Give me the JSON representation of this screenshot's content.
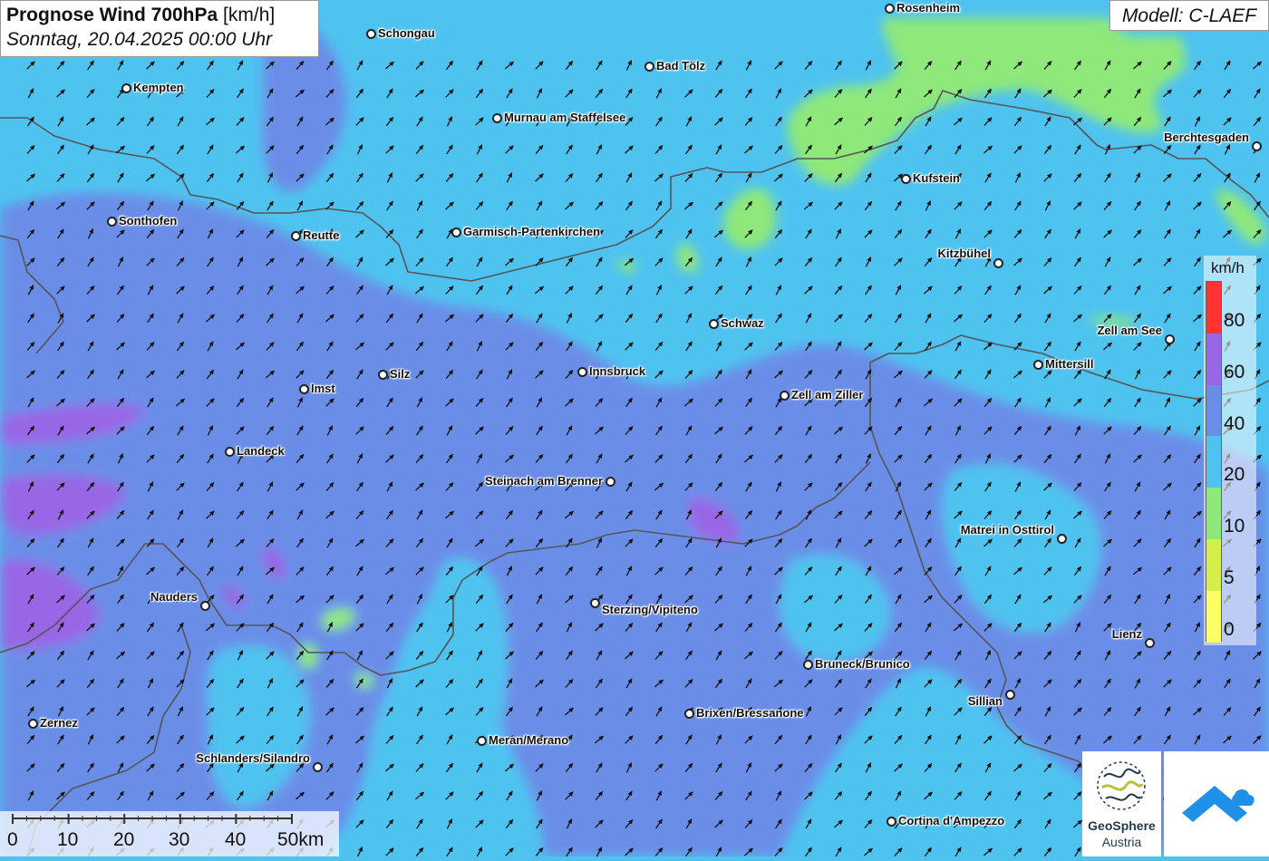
{
  "header": {
    "title_bold": "Prognose Wind 700hPa",
    "title_unit": "[km/h]",
    "subtitle": "Sonntag, 20.04.2025 00:00 Uhr",
    "model": "Modell: C-LAEF"
  },
  "colors": {
    "speed_0_5": "#ffff66",
    "speed_5_10": "#d4ef4a",
    "speed_10_20": "#8ee87a",
    "speed_20_40": "#4fc3f0",
    "speed_40_60": "#6a8ee8",
    "speed_60_80": "#9966e6",
    "speed_80_plus": "#ff3333",
    "border": "#555555",
    "arrow": "#111111"
  },
  "legend": {
    "unit": "km/h",
    "labels": [
      "80",
      "60",
      "40",
      "20",
      "10",
      "5",
      "0"
    ]
  },
  "scale_bar": {
    "labels": [
      "0",
      "10",
      "20",
      "30",
      "40",
      "50km"
    ]
  },
  "cities": [
    {
      "name": "Rosenheim"
    },
    {
      "name": "Schongau"
    },
    {
      "name": "Bad Tölz"
    },
    {
      "name": "Kempten"
    },
    {
      "name": "Murnau am Staffelsee"
    },
    {
      "name": "Berchtesgaden"
    },
    {
      "name": "Kufstein"
    },
    {
      "name": "Sonthofen"
    },
    {
      "name": "Reutte"
    },
    {
      "name": "Garmisch-Partenkirchen"
    },
    {
      "name": "Kitzbühel"
    },
    {
      "name": "Schwaz"
    },
    {
      "name": "Zell am See"
    },
    {
      "name": "Mittersill"
    },
    {
      "name": "Silz"
    },
    {
      "name": "Innsbruck"
    },
    {
      "name": "Imst"
    },
    {
      "name": "Zell am Ziller"
    },
    {
      "name": "Landeck"
    },
    {
      "name": "Steinach am Brenner"
    },
    {
      "name": "Matrei in Osttirol"
    },
    {
      "name": "Nauders"
    },
    {
      "name": "Sterzing/Vipiteno"
    },
    {
      "name": "Lienz"
    },
    {
      "name": "Bruneck/Brunico"
    },
    {
      "name": "Sillian"
    },
    {
      "name": "Brixen/Bressanone"
    },
    {
      "name": "Zernez"
    },
    {
      "name": "Meran/Merano"
    },
    {
      "name": "Schlanders/Silandro"
    },
    {
      "name": "Cortina d'Ampezzo"
    }
  ],
  "logos": {
    "geosphere_line1": "GeoSphere",
    "geosphere_line2": "Austria"
  }
}
